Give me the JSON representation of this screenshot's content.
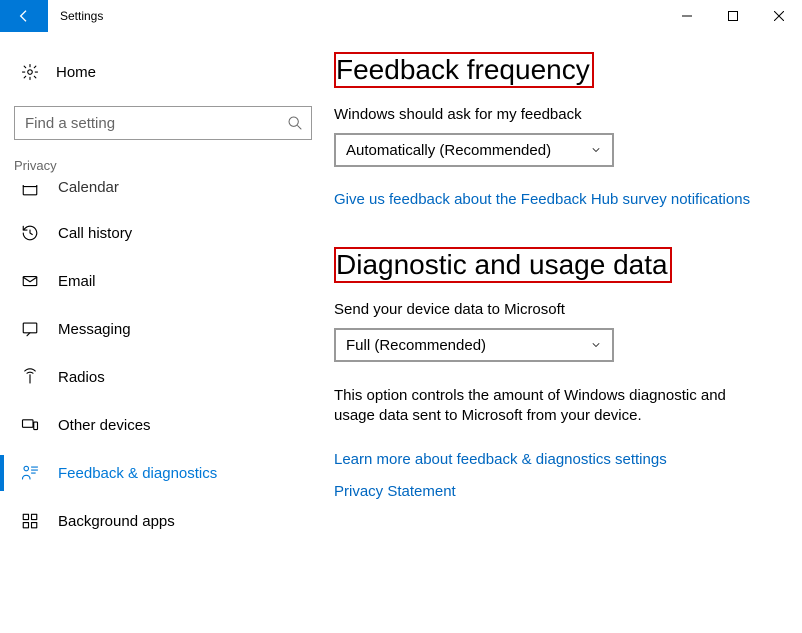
{
  "window": {
    "title": "Settings"
  },
  "sidebar": {
    "home_label": "Home",
    "search_placeholder": "Find a setting",
    "section_label": "Privacy",
    "items": [
      {
        "label": "Calendar"
      },
      {
        "label": "Call history"
      },
      {
        "label": "Email"
      },
      {
        "label": "Messaging"
      },
      {
        "label": "Radios"
      },
      {
        "label": "Other devices"
      },
      {
        "label": "Feedback & diagnostics"
      },
      {
        "label": "Background apps"
      }
    ]
  },
  "main": {
    "section1": {
      "heading": "Feedback frequency",
      "label": "Windows should ask for my feedback",
      "select_value": "Automatically (Recommended)",
      "link": "Give us feedback about the Feedback Hub survey notifications"
    },
    "section2": {
      "heading": "Diagnostic and usage data",
      "label": "Send your device data to Microsoft",
      "select_value": "Full (Recommended)",
      "description": "This option controls the amount of Windows diagnostic and usage data sent to Microsoft from your device.",
      "link1": "Learn more about feedback & diagnostics settings",
      "link2": "Privacy Statement"
    }
  }
}
